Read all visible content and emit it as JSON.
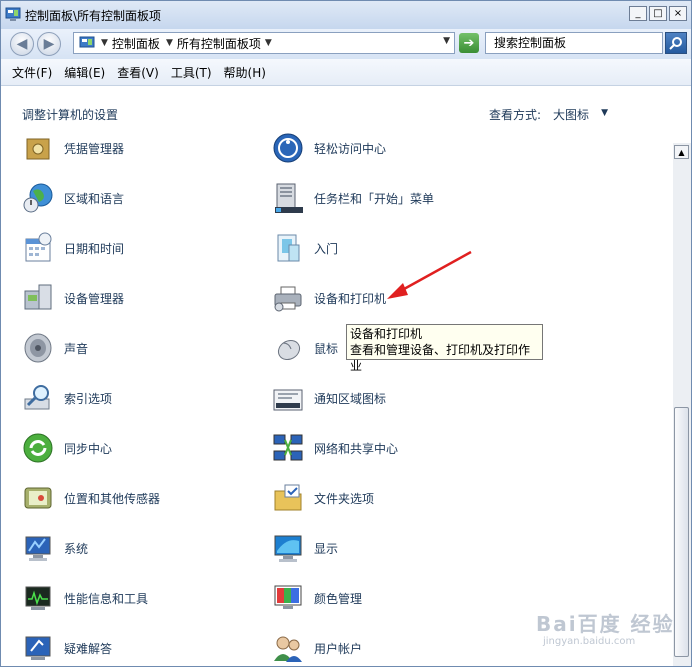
{
  "window": {
    "title": "控制面板\\所有控制面板项"
  },
  "address": {
    "segments": [
      "控制面板",
      "所有控制面板项"
    ]
  },
  "search": {
    "placeholder": "搜索控制面板"
  },
  "menu": [
    "文件(F)",
    "编辑(E)",
    "查看(V)",
    "工具(T)",
    "帮助(H)"
  ],
  "content": {
    "title": "调整计算机的设置",
    "view_label": "查看方式:",
    "view_value": "大图标"
  },
  "items_left": [
    "凭据管理器",
    "区域和语言",
    "日期和时间",
    "设备管理器",
    "声音",
    "索引选项",
    "同步中心",
    "位置和其他传感器",
    "系统",
    "性能信息和工具",
    "疑难解答"
  ],
  "items_right": [
    "轻松访问中心",
    "任务栏和「开始」菜单",
    "入门",
    "设备和打印机",
    "鼠标",
    "通知区域图标",
    "网络和共享中心",
    "文件夹选项",
    "显示",
    "颜色管理",
    "用户帐户"
  ],
  "tooltip": {
    "title": "设备和打印机",
    "desc": "查看和管理设备、打印机及打印作业"
  },
  "watermark": {
    "brand": "Bai百度 经验",
    "url": "jingyan.baidu.com"
  },
  "colors": {
    "link": "#1e3959",
    "accent": "#245a9f",
    "arrow": "#e02020"
  }
}
